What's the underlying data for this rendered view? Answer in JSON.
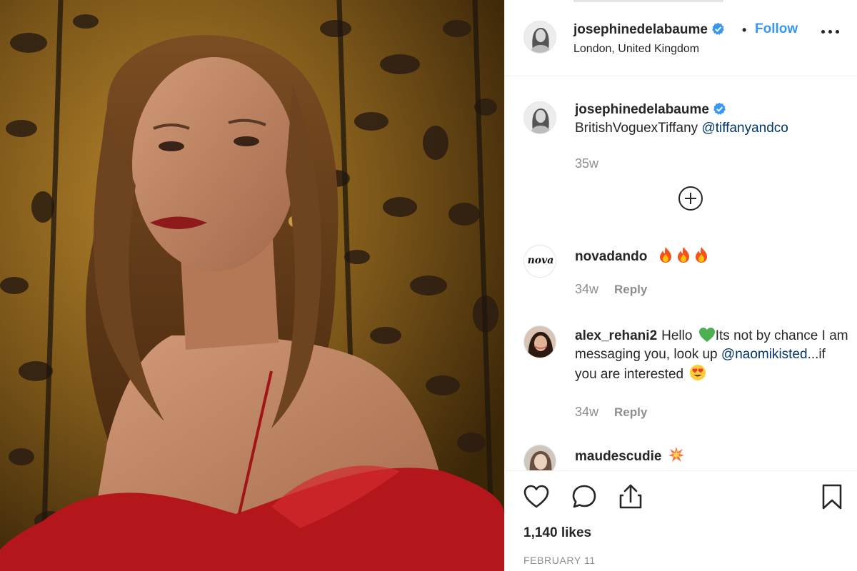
{
  "post": {
    "author": "josephinedelabaume",
    "location": "London, United Kingdom",
    "follow_label": "Follow",
    "dot": "•"
  },
  "caption": {
    "username": "josephinedelabaume",
    "text": "BritishVoguexTiffany",
    "mention": "@tiffanyandco",
    "age": "35w"
  },
  "comments": [
    {
      "username": "novadando",
      "avatar_text": "nova",
      "text": "",
      "emoji": "fire-emoji x3",
      "age": "34w",
      "reply_label": "Reply"
    },
    {
      "username": "alex_rehani2",
      "text_part1": "Hello",
      "text_part2": "Its not by chance I am messaging you, look up",
      "mention": "@naomikisted",
      "text_part3": "...if you are interested",
      "age": "34w",
      "reply_label": "Reply"
    },
    {
      "username": "maudescudie",
      "text": "",
      "emoji": "collision-emoji"
    }
  ],
  "likes": "1,140 likes",
  "date": "FEBRUARY 11",
  "colors": {
    "link": "#3897f0",
    "mention": "#003569",
    "text": "#262626",
    "muted": "#8e8e8e",
    "verified": "#3897f0"
  },
  "icons": [
    "verified-badge-icon",
    "more-options-icon",
    "load-more-plus-icon",
    "like-heart-icon",
    "comment-icon",
    "share-icon",
    "save-bookmark-icon"
  ]
}
